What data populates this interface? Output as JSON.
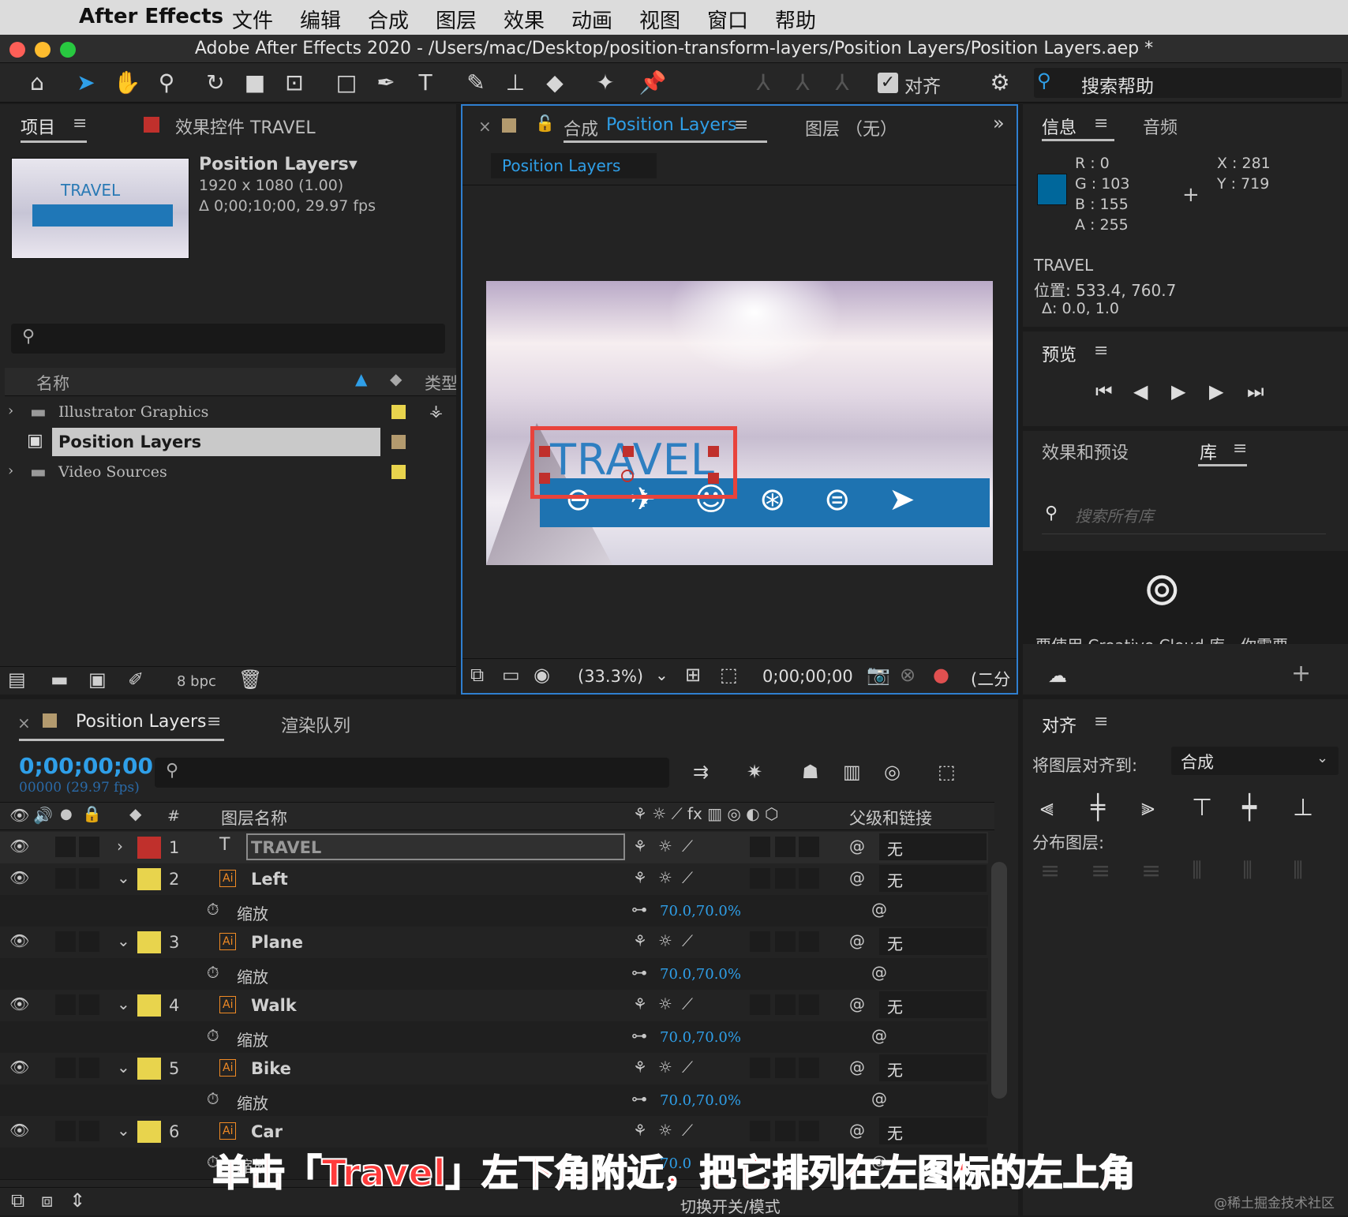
{
  "menubar": {
    "app": "After Effects",
    "items": [
      "文件",
      "编辑",
      "合成",
      "图层",
      "效果",
      "动画",
      "视图",
      "窗口",
      "帮助"
    ]
  },
  "window": {
    "title": "Adobe After Effects 2020 - /Users/mac/Desktop/position-transform-layers/Position Layers/Position Layers.aep *"
  },
  "toolbar": {
    "align_label": "对齐",
    "search_help": "搜索帮助"
  },
  "project_panel": {
    "tab_project": "项目",
    "tab_effects": "效果控件 TRAVEL",
    "comp_name": "Position Layers▾",
    "comp_size": "1920 x 1080 (1.00)",
    "comp_duration": "Δ 0;00;10;00, 29.97 fps",
    "thumb_text": "TRAVEL",
    "col_name": "名称",
    "col_type": "类型",
    "items": [
      {
        "name": "Illustrator Graphics",
        "color": "#e8d44d"
      },
      {
        "name": "Position Layers",
        "color": "#b39a6e"
      },
      {
        "name": "Video Sources",
        "color": "#e8d44d"
      }
    ],
    "bpc": "8 bpc"
  },
  "comp_panel": {
    "tab_label": "合成",
    "tab_name": "Position Layers",
    "layer_tab": "图层 （无）",
    "crumb": "Position Layers",
    "zoom": "(33.3%)",
    "timecode": "0;00;00;00",
    "resolution": "(二分",
    "frame_title": "TRAVEL"
  },
  "info_panel": {
    "tab_info": "信息",
    "tab_audio": "音频",
    "r": "R :  0",
    "g": "G :  103",
    "b": "B :  155",
    "a": "A :  255",
    "x": "X :  281",
    "y": "Y :  719",
    "swatch": "#00679b",
    "layer": "TRAVEL",
    "position": "位置: 533.4, 760.7",
    "delta": "Δ: 0.0, 1.0"
  },
  "preview_panel": {
    "title": "预览"
  },
  "effects_panel": {
    "tab_effects": "效果和预设",
    "tab_library": "库",
    "search_placeholder": "搜索所有库",
    "cc_text": "要使用 Creative Cloud 库，你需要"
  },
  "timeline": {
    "tab_name": "Position Layers",
    "tab_render": "渲染队列",
    "timecode": "0;00;00;00",
    "frames": "00000 (29.97 fps)",
    "col_num": "#",
    "col_name": "图层名称",
    "col_parent": "父级和链接",
    "toggle_label": "切换开关/模式",
    "layers": [
      {
        "num": "1",
        "name": "TRAVEL",
        "type": "T",
        "color": "#c0302c",
        "parent": "无",
        "expanded": false
      },
      {
        "num": "2",
        "name": "Left",
        "type": "Ai",
        "color": "#e8d44d",
        "parent": "无",
        "expanded": true,
        "prop": "缩放",
        "value": "70.0,70.0%"
      },
      {
        "num": "3",
        "name": "Plane",
        "type": "Ai",
        "color": "#e8d44d",
        "parent": "无",
        "expanded": true,
        "prop": "缩放",
        "value": "70.0,70.0%"
      },
      {
        "num": "4",
        "name": "Walk",
        "type": "Ai",
        "color": "#e8d44d",
        "parent": "无",
        "expanded": true,
        "prop": "缩放",
        "value": "70.0,70.0%"
      },
      {
        "num": "5",
        "name": "Bike",
        "type": "Ai",
        "color": "#e8d44d",
        "parent": "无",
        "expanded": true,
        "prop": "缩放",
        "value": "70.0,70.0%"
      },
      {
        "num": "6",
        "name": "Car",
        "type": "Ai",
        "color": "#e8d44d",
        "parent": "无",
        "expanded": true,
        "prop": "缩放",
        "value": "70.0"
      }
    ]
  },
  "align_panel": {
    "title": "对齐",
    "align_to_label": "将图层对齐到:",
    "align_to_value": "合成",
    "distribute_label": "分布图层:"
  },
  "caption": "单击「Travel」左下角附近，把它排列在左图标的左上角",
  "watermark": "@稀土掘金技术社区"
}
